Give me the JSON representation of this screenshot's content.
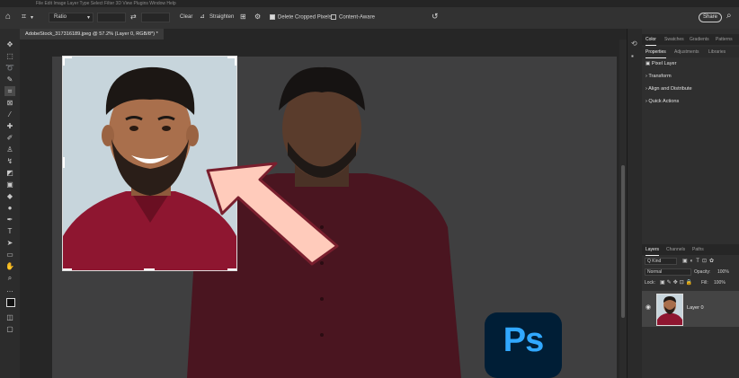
{
  "app": {
    "brand_colors": {
      "ps_bg": "#001e36",
      "ps_text": "#31a8ff",
      "accent_arrow": "#ffcbbb",
      "arrow_border": "#7a1f2e",
      "shirt": "#8e1630"
    }
  },
  "top_strip": {
    "text": "File  Edit  Image  Layer  Type  Select  Filter  3D  View  Plugins  Window  Help"
  },
  "options_bar": {
    "ratio_label": "Ratio",
    "clear_label": "Clear",
    "straighten_label": "Straighten",
    "delete_cropped_label": "Delete Cropped Pixels",
    "content_aware_label": "Content-Aware",
    "share_label": "Share"
  },
  "document": {
    "tab_title": "AdobeStock_317316189.jpeg @ 57.2% (Layer 0, RGB/8*) *"
  },
  "properties_panel": {
    "tabs": [
      "Color",
      "Swatches",
      "Gradients",
      "Patterns"
    ],
    "subtabs": [
      "Properties",
      "Adjustments",
      "Libraries"
    ],
    "pixel_layer_label": "Pixel Layer",
    "sections": [
      "Transform",
      "Align and Distribute",
      "Quick Actions"
    ]
  },
  "layers_panel": {
    "tabs": [
      "Layers",
      "Channels",
      "Paths"
    ],
    "filter_label": "Q Kind",
    "blend_mode": "Normal",
    "opacity_label": "Opacity:",
    "opacity_value": "100%",
    "lock_label": "Lock:",
    "fill_label": "Fill:",
    "fill_value": "100%",
    "layer_name": "Layer 0"
  },
  "logo": {
    "text": "Ps"
  },
  "icons": [
    "home-icon",
    "crop-tool-icon",
    "straighten-icon",
    "grid-overlay-icon",
    "settings-icon",
    "reset-icon",
    "search-icon",
    "eye-icon"
  ]
}
